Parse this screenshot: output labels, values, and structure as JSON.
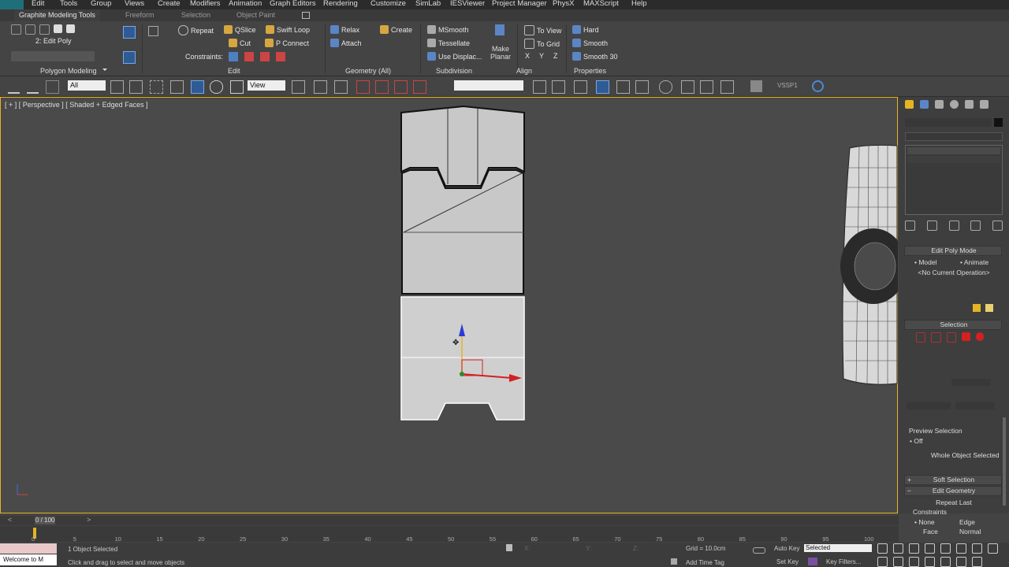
{
  "menu": [
    "Edit",
    "Tools",
    "Group",
    "Views",
    "Create",
    "Modifiers",
    "Animation",
    "Graph Editors",
    "Rendering",
    "Customize",
    "SimLab",
    "IESViewer",
    "Project Manager",
    "PhysX",
    "MAXScript",
    "Help"
  ],
  "ribbon_tabs": {
    "active": "Graphite Modeling Tools",
    "others": [
      "Freeform",
      "Selection",
      "Object Paint"
    ]
  },
  "ribbon": {
    "edit_poly_label": "2: Edit Poly",
    "polygon_modeling": "Polygon Modeling",
    "edit_group": {
      "repeat": "Repeat",
      "qslice": "QSlice",
      "swift_loop": "Swift Loop",
      "cut": "Cut",
      "p_connect": "P Connect",
      "constraints": "Constraints:",
      "title": "Edit"
    },
    "geometry_group": {
      "relax": "Relax",
      "create": "Create",
      "attach": "Attach",
      "title": "Geometry (All)"
    },
    "subdivision_group": {
      "msmooth": "MSmooth",
      "tessellate": "Tessellate",
      "use_displac": "Use Displac...",
      "title": "Subdivision"
    },
    "align_group": {
      "make_planar": "Make Planar",
      "to_view": "To View",
      "to_grid": "To Grid",
      "x": "X",
      "y": "Y",
      "z": "Z",
      "title": "Align"
    },
    "properties_group": {
      "hard": "Hard",
      "smooth": "Smooth",
      "smooth30": "Smooth 30",
      "title": "Properties"
    }
  },
  "toolbar": {
    "filter": "All",
    "ref_coord": "View",
    "named_sel": "VSSP1"
  },
  "viewport": {
    "label": "[ + ] [ Perspective ] [ Shaded + Edged Faces ]"
  },
  "command_panel": {
    "edit_poly_mode": "Edit Poly Mode",
    "model": "Model",
    "animate": "Animate",
    "no_op": "<No Current Operation>",
    "selection": "Selection",
    "preview_selection": "Preview Selection",
    "off": "Off",
    "whole_object": "Whole Object Selected",
    "soft_selection": "Soft Selection",
    "edit_geometry": "Edit Geometry",
    "repeat_last": "Repeat Last",
    "constraints": "Constraints",
    "none": "None",
    "edge": "Edge",
    "face": "Face",
    "normal": "Normal"
  },
  "timeline": {
    "frame": "0 / 100",
    "ticks": [
      "0",
      "5",
      "10",
      "15",
      "20",
      "25",
      "30",
      "35",
      "40",
      "45",
      "50",
      "55",
      "60",
      "65",
      "70",
      "75",
      "80",
      "85",
      "90",
      "95",
      "100"
    ]
  },
  "status": {
    "listener": "Welcome to M",
    "selected": "1 Object Selected",
    "prompt": "Click and drag to select and move objects",
    "grid": "Grid = 10.0cm",
    "add_time_tag": "Add Time Tag",
    "auto_key": "Auto Key",
    "set_key": "Set Key",
    "selected_dd": "Selected",
    "key_filters": "Key Filters..."
  },
  "colors": {
    "accent": "#e6b422",
    "viewport_bg": "#4a4a4a",
    "panel_bg": "#3e3e3e",
    "selection_red": "#d42020"
  }
}
